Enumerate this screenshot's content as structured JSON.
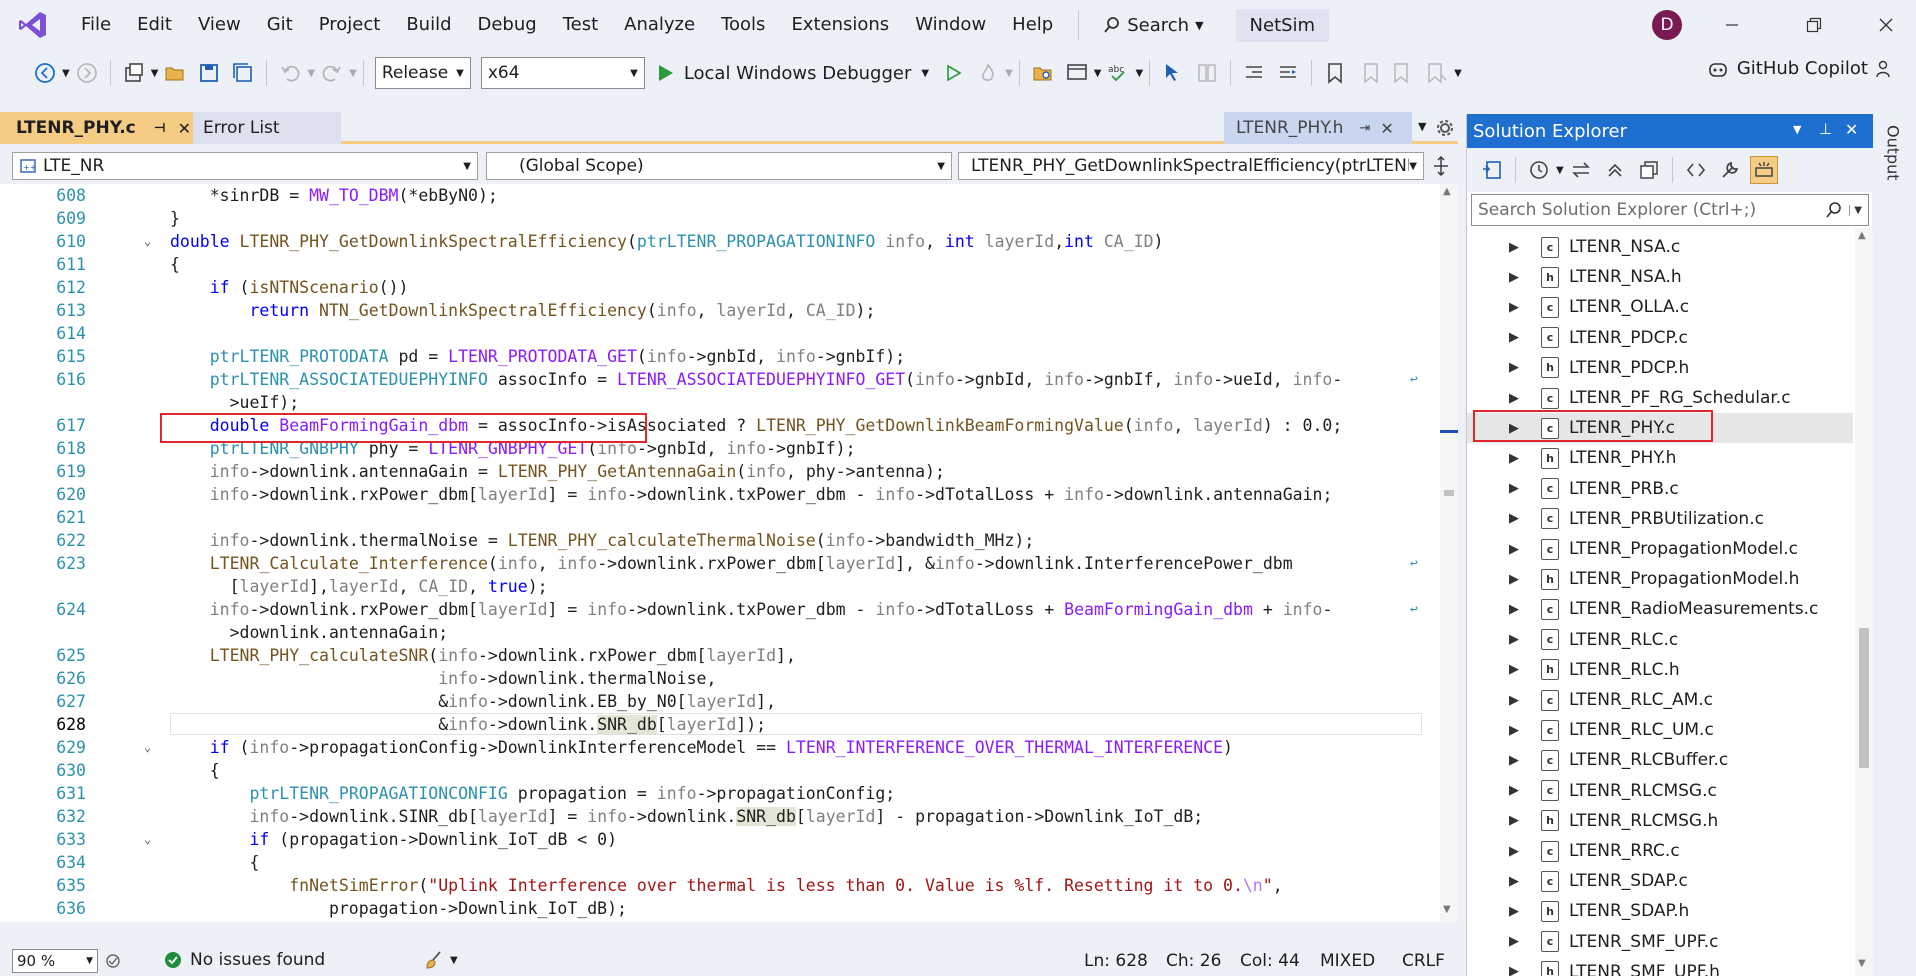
{
  "menu": {
    "items": [
      "File",
      "Edit",
      "View",
      "Git",
      "Project",
      "Build",
      "Debug",
      "Test",
      "Analyze",
      "Tools",
      "Extensions",
      "Window",
      "Help"
    ],
    "search_label": "Search",
    "app_name": "NetSim",
    "avatar_initial": "D"
  },
  "toolbar": {
    "configuration": "Release",
    "platform": "x64",
    "debugger_label": "Local Windows Debugger",
    "copilot_label": "GitHub Copilot"
  },
  "tabs": {
    "active": "LTENR_PHY.c",
    "error_list": "Error List",
    "preview": "LTENR_PHY.h"
  },
  "nav": {
    "project": "LTE_NR",
    "scope": "(Global Scope)",
    "member": "LTENR_PHY_GetDownlinkSpectralEfficiency(ptrLTENR_"
  },
  "status": {
    "zoom": "90 %",
    "issues": "No issues found",
    "ln": "Ln: 628",
    "ch": "Ch: 26",
    "col": "Col: 44",
    "encoding": "MIXED",
    "line_ending": "CRLF"
  },
  "solution_explorer": {
    "title": "Solution Explorer",
    "search_placeholder": "Search Solution Explorer (Ctrl+;)",
    "output_tab": "Output",
    "files": [
      {
        "name": "LTENR_NSA.c",
        "kind": "c"
      },
      {
        "name": "LTENR_NSA.h",
        "kind": "h"
      },
      {
        "name": "LTENR_OLLA.c",
        "kind": "c"
      },
      {
        "name": "LTENR_PDCP.c",
        "kind": "c"
      },
      {
        "name": "LTENR_PDCP.h",
        "kind": "h"
      },
      {
        "name": "LTENR_PF_RG_Schedular.c",
        "kind": "c"
      },
      {
        "name": "LTENR_PHY.c",
        "kind": "c"
      },
      {
        "name": "LTENR_PHY.h",
        "kind": "h"
      },
      {
        "name": "LTENR_PRB.c",
        "kind": "c"
      },
      {
        "name": "LTENR_PRBUtilization.c",
        "kind": "c"
      },
      {
        "name": "LTENR_PropagationModel.c",
        "kind": "c"
      },
      {
        "name": "LTENR_PropagationModel.h",
        "kind": "h"
      },
      {
        "name": "LTENR_RadioMeasurements.c",
        "kind": "c"
      },
      {
        "name": "LTENR_RLC.c",
        "kind": "c"
      },
      {
        "name": "LTENR_RLC.h",
        "kind": "h"
      },
      {
        "name": "LTENR_RLC_AM.c",
        "kind": "c"
      },
      {
        "name": "LTENR_RLC_UM.c",
        "kind": "c"
      },
      {
        "name": "LTENR_RLCBuffer.c",
        "kind": "c"
      },
      {
        "name": "LTENR_RLCMSG.c",
        "kind": "c"
      },
      {
        "name": "LTENR_RLCMSG.h",
        "kind": "h"
      },
      {
        "name": "LTENR_RRC.c",
        "kind": "c"
      },
      {
        "name": "LTENR_SDAP.c",
        "kind": "c"
      },
      {
        "name": "LTENR_SDAP.h",
        "kind": "h"
      },
      {
        "name": "LTENR_SMF_UPF.c",
        "kind": "c"
      },
      {
        "name": "LTENR_SMF_UPF.h",
        "kind": "h"
      }
    ]
  },
  "code": {
    "line_numbers": [
      "608",
      "609",
      "610",
      "611",
      "612",
      "613",
      "614",
      "615",
      "616",
      "",
      "617",
      "618",
      "619",
      "620",
      "621",
      "622",
      "623",
      "",
      "624",
      "",
      "625",
      "626",
      "627",
      "628",
      "629",
      "630",
      "631",
      "632",
      "633",
      "634",
      "635",
      "636"
    ],
    "lines": [
      "    *sinrDB = MW_TO_DBM(*ebByN0);",
      "}",
      "double LTENR_PHY_GetDownlinkSpectralEfficiency(ptrLTENR_PROPAGATIONINFO info, int layerId,int CA_ID)",
      "{",
      "    if (isNTNScenario())",
      "        return NTN_GetDownlinkSpectralEfficiency(info, layerId, CA_ID);",
      "",
      "    ptrLTENR_PROTODATA pd = LTENR_PROTODATA_GET(info->gnbId, info->gnbIf);",
      "    ptrLTENR_ASSOCIATEDUEPHYINFO assocInfo = LTENR_ASSOCIATEDUEPHYINFO_GET(info->gnbId, info->gnbIf, info->ueId, info-",
      "      >ueIf);",
      "    double BeamFormingGain_dbm = assocInfo->isAssociated ? LTENR_PHY_GetDownlinkBeamFormingValue(info, layerId) : 0.0;",
      "    ptrLTENR_GNBPHY phy = LTENR_GNBPHY_GET(info->gnbId, info->gnbIf);",
      "    info->downlink.antennaGain = LTENR_PHY_GetAntennaGain(info, phy->antenna);",
      "    info->downlink.rxPower_dbm[layerId] = info->downlink.txPower_dbm - info->dTotalLoss + info->downlink.antennaGain;",
      "",
      "    info->downlink.thermalNoise = LTENR_PHY_calculateThermalNoise(info->bandwidth_MHz);",
      "    LTENR_Calculate_Interference(info, info->downlink.rxPower_dbm[layerId], &info->downlink.InterferencePower_dbm",
      "      [layerId],layerId, CA_ID, true);",
      "    info->downlink.rxPower_dbm[layerId] = info->downlink.txPower_dbm - info->dTotalLoss + BeamFormingGain_dbm + info-",
      "      >downlink.antennaGain;",
      "    LTENR_PHY_calculateSNR(info->downlink.rxPower_dbm[layerId],",
      "                           info->downlink.thermalNoise,",
      "                           &info->downlink.EB_by_N0[layerId],",
      "                           &info->downlink.SNR_db[layerId]);",
      "    if (info->propagationConfig->DownlinkInterferenceModel == LTENR_INTERFERENCE_OVER_THERMAL_INTERFERENCE)",
      "    {",
      "        ptrLTENR_PROPAGATIONCONFIG propagation = info->propagationConfig;",
      "        info->downlink.SINR_db[layerId] = info->downlink.SNR_db[layerId] - propagation->Downlink_IoT_dB;",
      "        if (propagation->Downlink_IoT_dB < 0)",
      "        {",
      "            fnNetSimError(\"Uplink Interference over thermal is less than 0. Value is %lf. Resetting it to 0.\\n\",",
      "                propagation->Downlink_IoT_dB);"
    ]
  },
  "colors": {
    "accent_blue": "#1f6fd1",
    "tab_active": "#f5cc84",
    "highlight_red": "#e0262f"
  }
}
